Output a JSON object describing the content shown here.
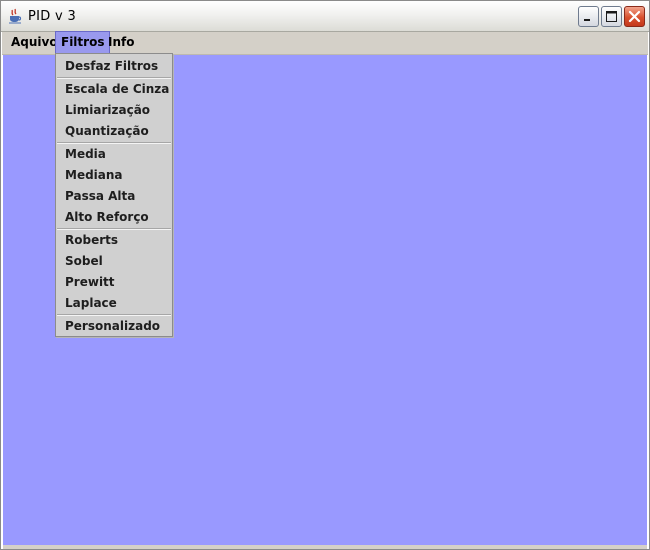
{
  "window": {
    "title": "PID v 3"
  },
  "menubar": [
    {
      "label": "Aquivo"
    },
    {
      "label": "Filtros",
      "active": true
    },
    {
      "label": "Info"
    }
  ],
  "dropdown": {
    "groups": [
      [
        "Desfaz Filtros"
      ],
      [
        "Escala de Cinza",
        "Limiarização",
        "Quantização"
      ],
      [
        "Media",
        "Mediana",
        "Passa Alta",
        "Alto Reforço"
      ],
      [
        "Roberts",
        "Sobel",
        "Prewitt",
        "Laplace"
      ],
      [
        "Personalizado"
      ]
    ]
  },
  "colors": {
    "canvas": "#9999ff",
    "menu_highlight": "#9999ee",
    "menu_bg": "#d0d0d0"
  }
}
